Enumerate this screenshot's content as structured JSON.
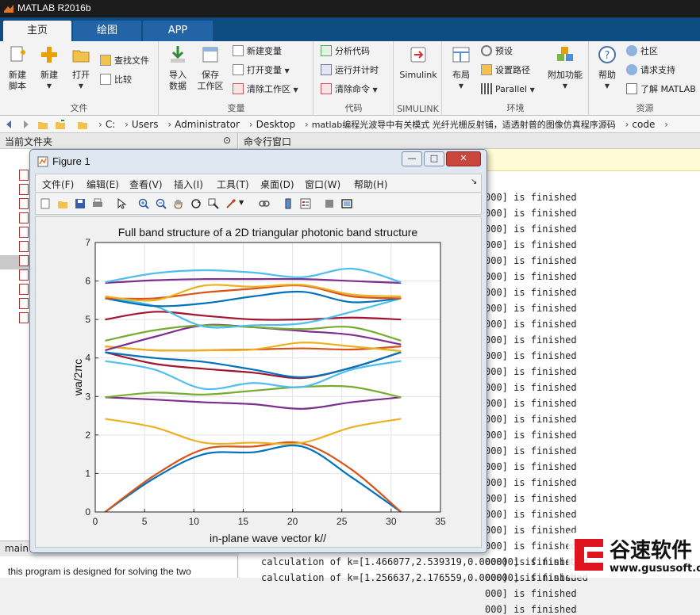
{
  "app": {
    "title": "MATLAB R2016b"
  },
  "ribbon_tabs": [
    "主页",
    "绘图",
    "APP"
  ],
  "ribbon": {
    "file_group": {
      "label": "文件",
      "new_script": "新建\n脚本",
      "new": "新建",
      "open": "打开",
      "find_files": "查找文件",
      "compare": "比较"
    },
    "variable_group": {
      "label": "变量",
      "import": "导入\n数据",
      "save_ws": "保存\n工作区",
      "new_var": "新建变量",
      "open_var": "打开变量",
      "clear_ws": "清除工作区"
    },
    "code_group": {
      "label": "代码",
      "analyze": "分析代码",
      "run_time": "运行并计时",
      "clear_cmd": "清除命令"
    },
    "simulink_group": {
      "label": "SIMULINK",
      "simulink": "Simulink"
    },
    "env_group": {
      "label": "环境",
      "layout": "布局",
      "prefs": "预设",
      "set_path": "设置路径",
      "parallel": "Parallel",
      "addons": "附加功能"
    },
    "resources_group": {
      "label": "资源",
      "help": "帮助",
      "community": "社区",
      "support": "请求支持",
      "learn": "了解 MATLAB"
    }
  },
  "address": {
    "crumbs": [
      "C:",
      "Users",
      "Administrator",
      "Desktop",
      "matlab编程光波导中有关模式 光纤光栅反射铺，适透射普的图像仿真程序源码",
      "code"
    ]
  },
  "left_panel": {
    "header": "当前文件夹",
    "main_label": "main",
    "description": "this program is designed for solving the two"
  },
  "command_window": {
    "header": "命令行窗口",
    "finished_lines": [
      "000] is finished",
      "000] is finished",
      "000] is finished",
      "000] is finished",
      "000] is finished",
      "000] is finished",
      "000] is finished",
      "000] is finished",
      "000] is finished",
      "000] is finished",
      "000] is finished",
      "000] is finished",
      "000] is finished",
      "000] is finished",
      "000] is finished",
      "000] is finished",
      "000] is finished",
      "000] is finished",
      "000] is finished",
      "000] is finished",
      "000] is finished",
      "000] is finished",
      "000] is finished",
      "000] is finished",
      "000] is finished",
      "000] is finished",
      "000] is finished"
    ],
    "calc_line_1": "calculation of k=[1.466077,2.539319,0.000000] is finished",
    "calc_line_2": "calculation of k=[1.256637,2.176559,0.000000] is finished"
  },
  "watermark": {
    "brand": "谷速软件",
    "url": "www.gususoft.com"
  },
  "figure": {
    "title": "Figure 1",
    "menu": [
      "文件(F)",
      "编辑(E)",
      "查看(V)",
      "插入(I)",
      "工具(T)",
      "桌面(D)",
      "窗口(W)",
      "帮助(H)"
    ],
    "min_label": "—",
    "max_label": "□",
    "close_label": "✕"
  },
  "chart_data": {
    "type": "line",
    "title": "Full band structure of a 2D triangular photonic band structure",
    "xlabel": "in-plane wave vector k//",
    "ylabel": "wa/2πc",
    "xlim": [
      0,
      35
    ],
    "ylim": [
      0,
      7
    ],
    "xticks": [
      0,
      5,
      10,
      15,
      20,
      25,
      30,
      35
    ],
    "yticks": [
      0,
      1,
      2,
      3,
      4,
      5,
      6,
      7
    ],
    "grid": true,
    "x": [
      1,
      6,
      11,
      16,
      21,
      26,
      31
    ],
    "series": [
      {
        "color": "#0072bd",
        "values": [
          0.0,
          0.88,
          1.5,
          1.55,
          1.7,
          0.9,
          0.0
        ]
      },
      {
        "color": "#d95319",
        "values": [
          0.0,
          0.95,
          1.63,
          1.7,
          1.78,
          1.1,
          0.0
        ]
      },
      {
        "color": "#edb120",
        "values": [
          2.42,
          2.2,
          1.8,
          1.8,
          1.8,
          2.2,
          2.42
        ]
      },
      {
        "color": "#7e2f8e",
        "values": [
          2.98,
          2.92,
          2.85,
          2.8,
          2.68,
          2.85,
          2.98
        ]
      },
      {
        "color": "#77ac30",
        "values": [
          2.98,
          3.1,
          3.05,
          3.15,
          3.25,
          3.25,
          2.98
        ]
      },
      {
        "color": "#4dbeee",
        "values": [
          3.92,
          3.7,
          3.2,
          3.35,
          3.25,
          3.7,
          3.92
        ]
      },
      {
        "color": "#a2142f",
        "values": [
          4.15,
          3.85,
          3.72,
          3.62,
          3.48,
          3.75,
          4.15
        ]
      },
      {
        "color": "#0072bd",
        "values": [
          4.15,
          4.0,
          3.9,
          3.7,
          3.5,
          3.75,
          4.15
        ]
      },
      {
        "color": "#d95319",
        "values": [
          4.3,
          4.2,
          4.2,
          4.22,
          4.25,
          4.22,
          4.3
        ]
      },
      {
        "color": "#edb120",
        "values": [
          4.3,
          4.2,
          4.2,
          4.22,
          4.4,
          4.3,
          4.18
        ]
      },
      {
        "color": "#7e2f8e",
        "values": [
          4.2,
          4.55,
          4.85,
          4.8,
          4.7,
          4.6,
          4.35
        ]
      },
      {
        "color": "#77ac30",
        "values": [
          4.45,
          4.72,
          4.85,
          4.8,
          4.75,
          4.8,
          4.45
        ]
      },
      {
        "color": "#a2142f",
        "values": [
          5.0,
          5.2,
          5.1,
          5.0,
          5.0,
          5.05,
          5.0
        ]
      },
      {
        "color": "#4dbeee",
        "values": [
          5.55,
          5.35,
          4.82,
          4.85,
          4.9,
          5.2,
          5.55
        ]
      },
      {
        "color": "#0072bd",
        "values": [
          5.55,
          5.35,
          5.42,
          5.6,
          5.72,
          5.45,
          5.55
        ]
      },
      {
        "color": "#d95319",
        "values": [
          5.55,
          5.55,
          5.7,
          5.8,
          5.88,
          5.6,
          5.55
        ]
      },
      {
        "color": "#edb120",
        "values": [
          5.6,
          5.5,
          5.88,
          5.85,
          5.9,
          5.65,
          5.6
        ]
      },
      {
        "color": "#7e2f8e",
        "values": [
          5.95,
          6.02,
          6.05,
          6.05,
          6.05,
          6.0,
          5.95
        ]
      },
      {
        "color": "#4dbeee",
        "values": [
          5.97,
          6.2,
          6.28,
          6.22,
          6.1,
          6.32,
          5.97
        ]
      }
    ]
  }
}
